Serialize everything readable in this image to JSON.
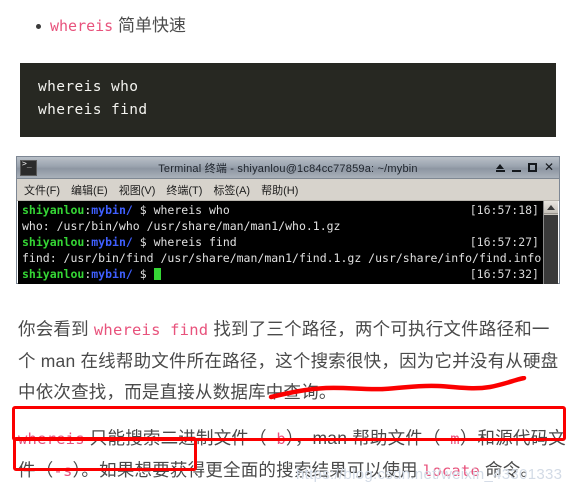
{
  "bullet_list": {
    "items": [
      {
        "code": "whereis",
        "text": " 简单快速"
      }
    ]
  },
  "code_block": {
    "lines": [
      "whereis who",
      "whereis find"
    ]
  },
  "terminal": {
    "title": "Terminal 终端 - shiyanlou@1c84cc77859a: ~/mybin",
    "app_icon": "terminal-icon",
    "window_buttons": {
      "shade": "shade-button",
      "minimize": "minimize-button",
      "maximize": "maximize-button",
      "close": "close-button"
    },
    "menus": [
      "文件(F)",
      "编辑(E)",
      "视图(V)",
      "终端(T)",
      "标签(A)",
      "帮助(H)"
    ],
    "prompt": {
      "user": "shiyanlou",
      "colon": ":",
      "path": "mybin/",
      "sigil": " $ "
    },
    "lines": [
      {
        "type": "prompt",
        "command": "whereis who",
        "time": "[16:57:18]"
      },
      {
        "type": "output",
        "text": "who: /usr/bin/who /usr/share/man/man1/who.1.gz"
      },
      {
        "type": "prompt",
        "command": "whereis find",
        "time": "[16:57:27]"
      },
      {
        "type": "output",
        "text": "find: /usr/bin/find /usr/share/man/man1/find.1.gz /usr/share/info/find.info.gz"
      },
      {
        "type": "prompt",
        "command": "",
        "time": "[16:57:32]",
        "cursor": true
      }
    ],
    "scrollbar": {
      "up_arrow": "scroll-up-arrow"
    }
  },
  "paragraph_1": {
    "seg1": "你会看到 ",
    "code1": "whereis find",
    "seg2": " 找到了三个路径，两个可执行文件路径和一个 man 在线帮助文件所在路径，这个搜索很快，因为它并没有从硬盘中依次查找，而是直接从数据库中查询。"
  },
  "paragraph_2": {
    "code1": "whereis",
    "seg1": " 只能搜索二进制文件（",
    "code2": "-b",
    "seg2": "），man 帮助文件（",
    "code3": "-m",
    "seg3": "）和源代码文件（",
    "code4": "-s",
    "seg4": "）。如果想要获得更全面的搜索结果可以使用 ",
    "code5": "locate",
    "seg5": " 命令。"
  },
  "watermark": {
    "text": "https://blog.csdn.net/weixin_43301333"
  },
  "colors": {
    "inline_code": "#e8527c",
    "annotation_red": "#fb0000",
    "code_block_bg": "#272822",
    "terminal_green": "#35d635",
    "terminal_blue": "#3f5fff",
    "watermark": "#d3dbe6"
  }
}
